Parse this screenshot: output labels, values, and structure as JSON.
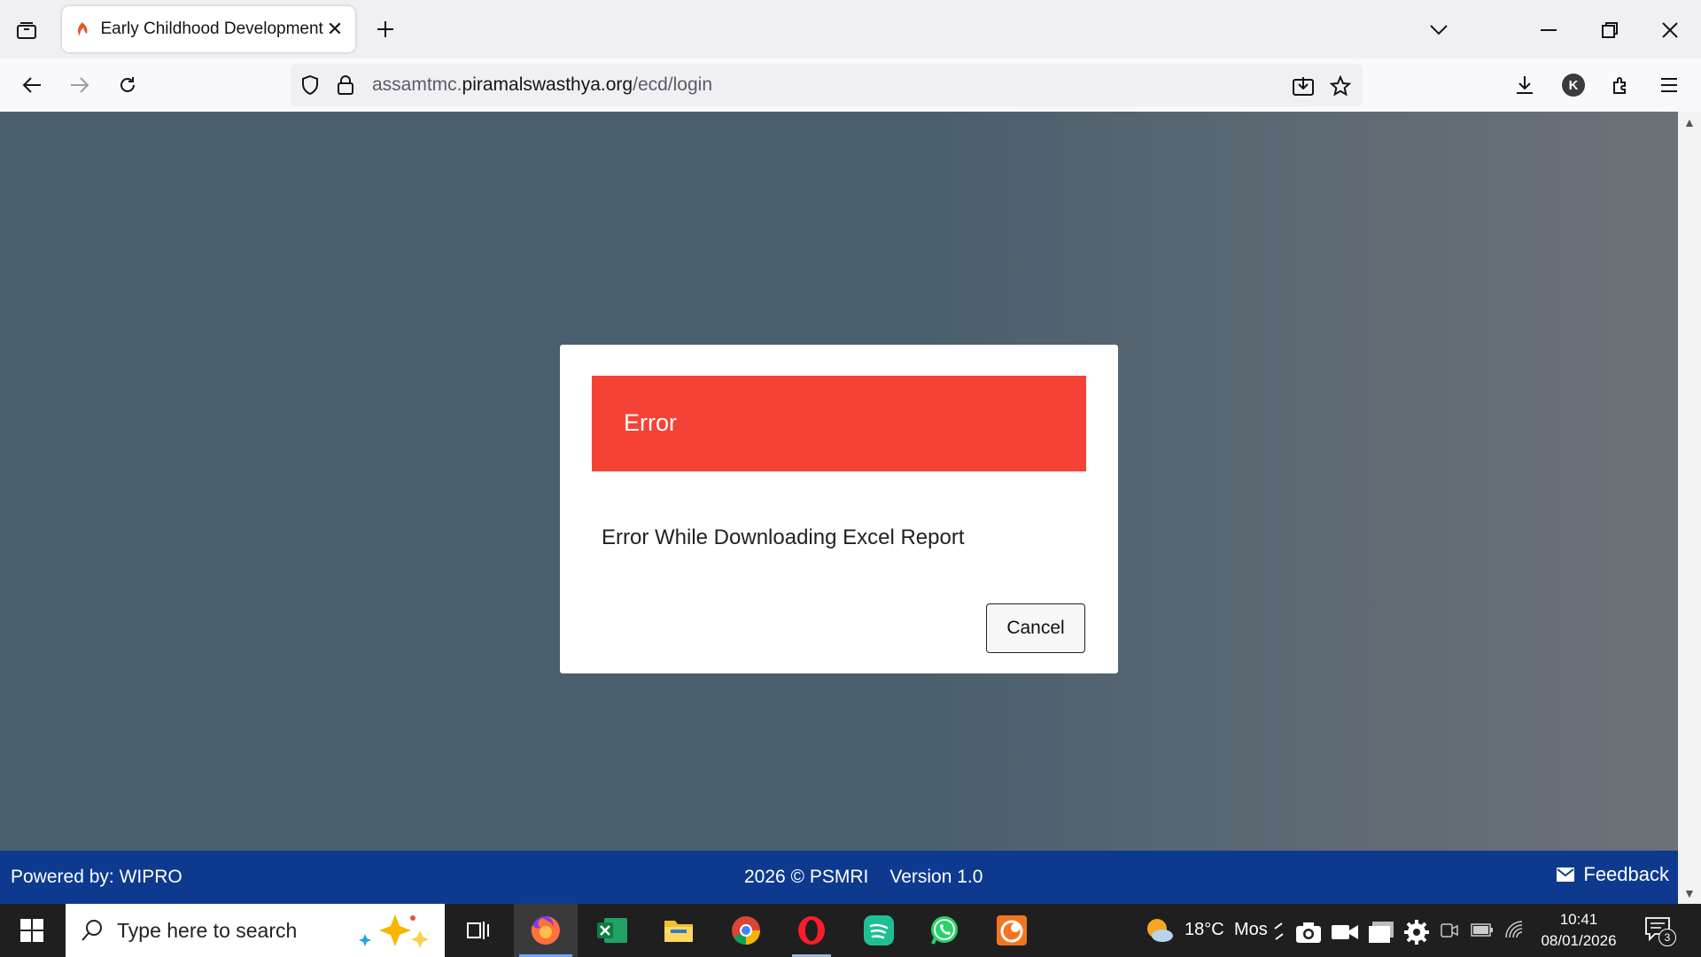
{
  "browser": {
    "tab_title": "Early Childhood Development",
    "url_host_prefix": "assamtmc.",
    "url_host_main": "piramalswasthya.org",
    "url_path": "/ecd/login",
    "account_initial": "K"
  },
  "dialog": {
    "title": "Error",
    "message": "Error While Downloading Excel Report",
    "cancel_label": "Cancel",
    "header_color": "#f44336"
  },
  "footer": {
    "powered_by": "Powered by: WIPRO",
    "copyright": "2026 © PSMRI",
    "version": "Version 1.0",
    "feedback": "Feedback",
    "color": "#0d3a8f"
  },
  "taskbar": {
    "search_placeholder": "Type here to search",
    "apps": [
      "task-view",
      "firefox",
      "excel",
      "file-explorer",
      "chrome",
      "opera",
      "spotify",
      "whatsapp",
      "crunchyroll"
    ],
    "weather_temp": "18°C",
    "weather_text": "Mos",
    "time": "10:41",
    "date": "08/01/2026",
    "notification_count": "3"
  }
}
